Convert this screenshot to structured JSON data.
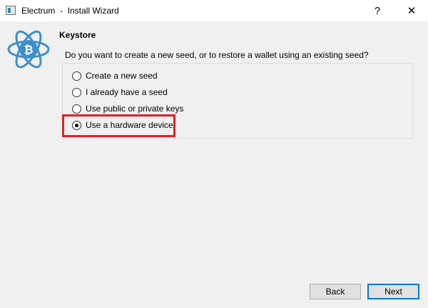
{
  "window": {
    "title": "Electrum  -  Install Wizard",
    "help_label": "?",
    "close_label": "✕"
  },
  "page": {
    "heading": "Keystore",
    "question": "Do you want to create a new seed, or to restore a wallet using an existing seed?"
  },
  "options": [
    {
      "label": "Create a new seed",
      "checked": false
    },
    {
      "label": "I already have a seed",
      "checked": false
    },
    {
      "label": "Use public or private keys",
      "checked": false
    },
    {
      "label": "Use a hardware device",
      "checked": true
    }
  ],
  "buttons": {
    "back_label": "Back",
    "next_label": "Next"
  },
  "colors": {
    "logo": "#3e8fc9",
    "highlight": "#e0202a",
    "default_button_border": "#0078d7"
  },
  "icons": {
    "app": "electrum-app-icon",
    "logo": "electrum-bitcoin-atom-logo"
  }
}
